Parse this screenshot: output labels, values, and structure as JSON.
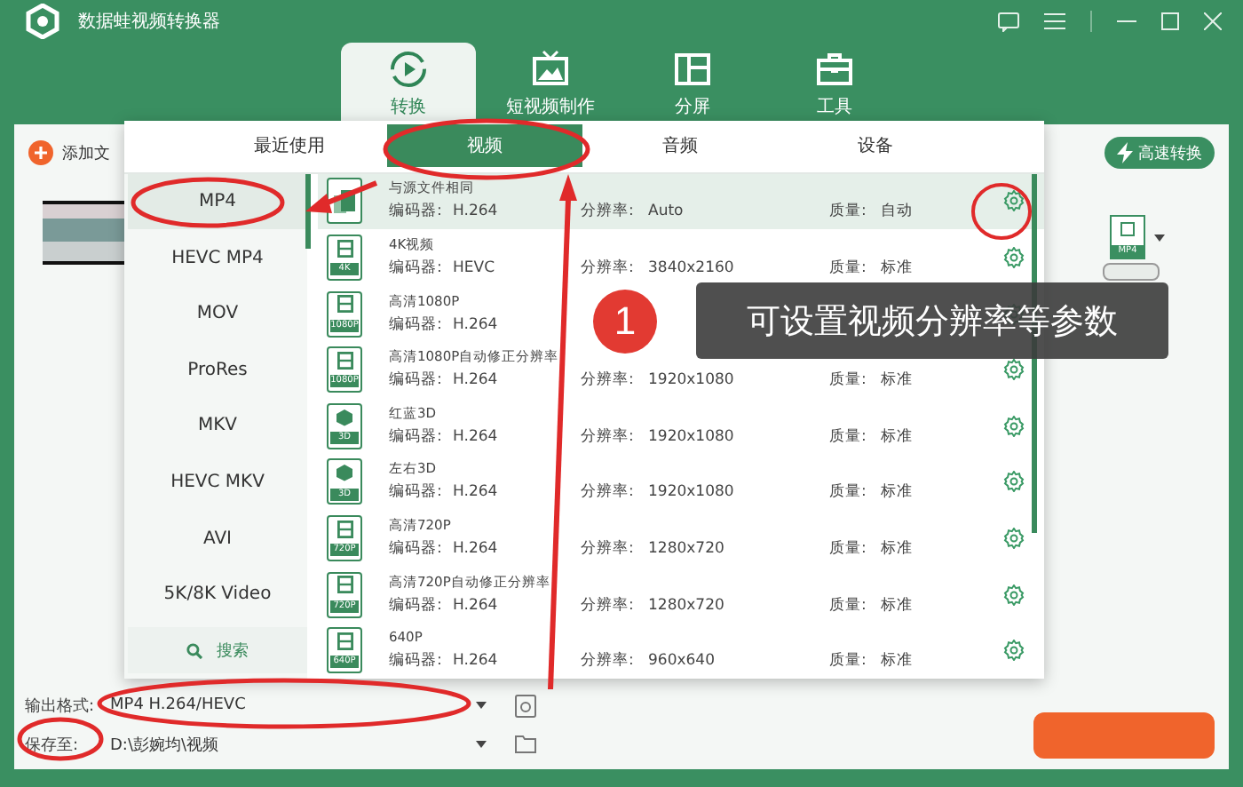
{
  "window": {
    "title": "数据蛙视频转换器"
  },
  "main_tabs": [
    {
      "label": "转换",
      "kind": "convert",
      "selected": true
    },
    {
      "label": "短视频制作",
      "kind": "video",
      "selected": false
    },
    {
      "label": "分屏",
      "kind": "split",
      "selected": false
    },
    {
      "label": "工具",
      "kind": "tools",
      "selected": false
    }
  ],
  "toolbar": {
    "add_file": "添加文",
    "fast_convert": "高速转换"
  },
  "file_item": {
    "format_badge": "MP4"
  },
  "format_popup": {
    "tabs": [
      {
        "label": "最近使用",
        "selected": false
      },
      {
        "label": "视频",
        "selected": true
      },
      {
        "label": "音频",
        "selected": false
      },
      {
        "label": "设备",
        "selected": false
      }
    ],
    "formats": [
      {
        "label": "MP4",
        "selected": true
      },
      {
        "label": "HEVC MP4",
        "selected": false
      },
      {
        "label": "MOV",
        "selected": false
      },
      {
        "label": "ProRes",
        "selected": false
      },
      {
        "label": "MKV",
        "selected": false
      },
      {
        "label": "HEVC MKV",
        "selected": false
      },
      {
        "label": "AVI",
        "selected": false
      },
      {
        "label": "5K/8K Video",
        "selected": false
      }
    ],
    "search": "搜索",
    "presets": [
      {
        "name": "与源文件相同",
        "kind": "source",
        "encoder_label": "编码器:",
        "encoder": "H.264",
        "resolution_label": "分辨率:",
        "resolution": "Auto",
        "quality_label": "质量:",
        "quality": "自动",
        "selected": true
      },
      {
        "name": "4K视频",
        "kind": "film",
        "badge": "4K",
        "encoder_label": "编码器:",
        "encoder": "HEVC",
        "resolution_label": "分辨率:",
        "resolution": "3840x2160",
        "quality_label": "质量:",
        "quality": "标准",
        "selected": false
      },
      {
        "name": "高清1080P",
        "kind": "film",
        "badge": "1080P",
        "encoder_label": "编码器:",
        "encoder": "H.264",
        "selected": false
      },
      {
        "name": "高清1080P自动修正分辨率",
        "kind": "film",
        "badge": "1080P",
        "encoder_label": "编码器:",
        "encoder": "H.264",
        "resolution_label": "分辨率:",
        "resolution": "1920x1080",
        "quality_label": "质量:",
        "quality": "标准",
        "selected": false
      },
      {
        "name": "红蓝3D",
        "kind": "cube",
        "badge": "3D",
        "encoder_label": "编码器:",
        "encoder": "H.264",
        "resolution_label": "分辨率:",
        "resolution": "1920x1080",
        "quality_label": "质量:",
        "quality": "标准",
        "selected": false
      },
      {
        "name": "左右3D",
        "kind": "cube",
        "badge": "3D",
        "encoder_label": "编码器:",
        "encoder": "H.264",
        "resolution_label": "分辨率:",
        "resolution": "1920x1080",
        "quality_label": "质量:",
        "quality": "标准",
        "selected": false
      },
      {
        "name": "高清720P",
        "kind": "film",
        "badge": "720P",
        "encoder_label": "编码器:",
        "encoder": "H.264",
        "resolution_label": "分辨率:",
        "resolution": "1280x720",
        "quality_label": "质量:",
        "quality": "标准",
        "selected": false
      },
      {
        "name": "高清720P自动修正分辨率",
        "kind": "film",
        "badge": "720P",
        "encoder_label": "编码器:",
        "encoder": "H.264",
        "resolution_label": "分辨率:",
        "resolution": "1280x720",
        "quality_label": "质量:",
        "quality": "标准",
        "selected": false
      },
      {
        "name": "640P",
        "kind": "film",
        "badge": "640P",
        "encoder_label": "编码器:",
        "encoder": "H.264",
        "resolution_label": "分辨率:",
        "resolution": "960x640",
        "quality_label": "质量:",
        "quality": "标准",
        "selected": false
      }
    ]
  },
  "output": {
    "format_label": "输出格式:",
    "format": "MP4 H.264/HEVC",
    "save_label": "保存至:",
    "save_path": "D:\\彭婉均\\视频"
  },
  "annotation": {
    "step": "1",
    "text": "可设置视频分辨率等参数"
  }
}
